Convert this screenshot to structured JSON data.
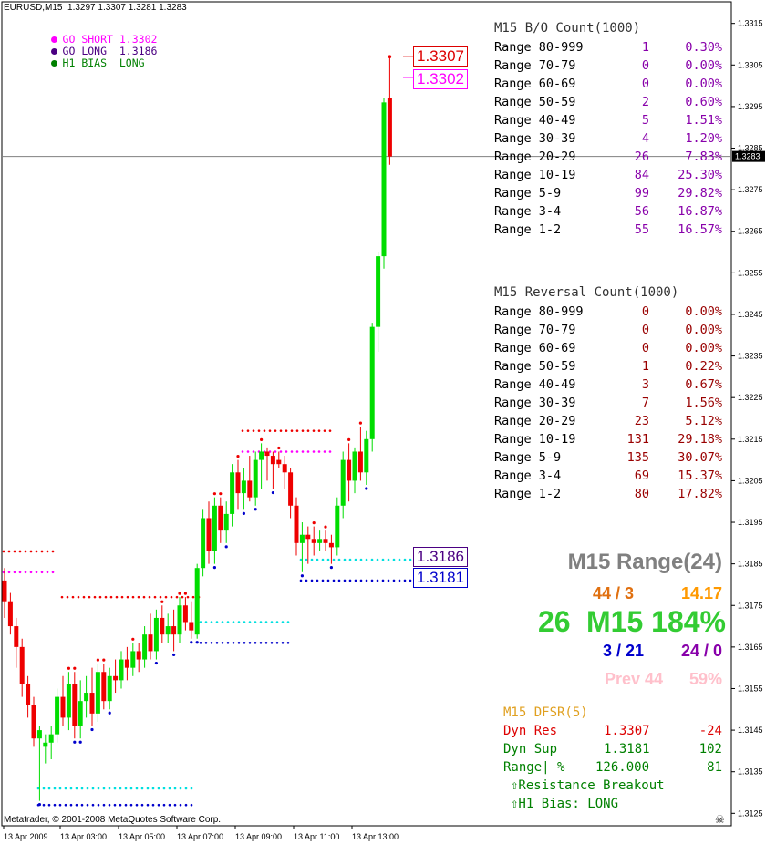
{
  "header": {
    "symbol_info": "EURUSD,M15  1.3297 1.3307 1.3281 1.3283",
    "signals": [
      {
        "label": "GO SHORT",
        "value": "1.3302",
        "color": "#ff00ff"
      },
      {
        "label": "GO LONG",
        "value": "1.3186",
        "color": "#4b0082"
      },
      {
        "label": "H1 BIAS",
        "value": "LONG",
        "color": "#008000"
      }
    ]
  },
  "copyright": "Metatrader, © 2001-2008 MetaQuotes Software Corp.",
  "current_price_label": "1.3283",
  "level_boxes": [
    {
      "name": "resistance-high",
      "value": "1.3307",
      "color": "#dd0000"
    },
    {
      "name": "go-short-level",
      "value": "1.3302",
      "color": "#ff00ff"
    },
    {
      "name": "go-long-level",
      "value": "1.3186",
      "color": "#4b0082"
    },
    {
      "name": "support-low",
      "value": "1.3181",
      "color": "#0000cc"
    }
  ],
  "bo_count": {
    "title": "M15 B/O Count(1000)",
    "rows": [
      {
        "label": "Range 80-999",
        "count": "1",
        "pct": "0.30%"
      },
      {
        "label": "Range 70-79",
        "count": "0",
        "pct": "0.00%"
      },
      {
        "label": "Range 60-69",
        "count": "0",
        "pct": "0.00%"
      },
      {
        "label": "Range 50-59",
        "count": "2",
        "pct": "0.60%"
      },
      {
        "label": "Range 40-49",
        "count": "5",
        "pct": "1.51%"
      },
      {
        "label": "Range 30-39",
        "count": "4",
        "pct": "1.20%"
      },
      {
        "label": "Range 20-29",
        "count": "26",
        "pct": "7.83%"
      },
      {
        "label": "Range 10-19",
        "count": "84",
        "pct": "25.30%"
      },
      {
        "label": "Range 5-9",
        "count": "99",
        "pct": "29.82%"
      },
      {
        "label": "Range 3-4",
        "count": "56",
        "pct": "16.87%"
      },
      {
        "label": "Range 1-2",
        "count": "55",
        "pct": "16.57%"
      }
    ]
  },
  "reversal_count": {
    "title": "M15 Reversal Count(1000)",
    "rows": [
      {
        "label": "Range 80-999",
        "count": "0",
        "pct": "0.00%"
      },
      {
        "label": "Range 70-79",
        "count": "0",
        "pct": "0.00%"
      },
      {
        "label": "Range 60-69",
        "count": "0",
        "pct": "0.00%"
      },
      {
        "label": "Range 50-59",
        "count": "1",
        "pct": "0.22%"
      },
      {
        "label": "Range 40-49",
        "count": "3",
        "pct": "0.67%"
      },
      {
        "label": "Range 30-39",
        "count": "7",
        "pct": "1.56%"
      },
      {
        "label": "Range 20-29",
        "count": "23",
        "pct": "5.12%"
      },
      {
        "label": "Range 10-19",
        "count": "131",
        "pct": "29.18%"
      },
      {
        "label": "Range 5-9",
        "count": "135",
        "pct": "30.07%"
      },
      {
        "label": "Range 3-4",
        "count": "69",
        "pct": "15.37%"
      },
      {
        "label": "Range 1-2",
        "count": "80",
        "pct": "17.82%"
      }
    ]
  },
  "range_panel": {
    "title": "M15 Range(24)",
    "ratio_a": "44 / 3",
    "value_a": "14.17",
    "current": "26",
    "current_label": "M15 184%",
    "ratio_b": "3 / 21",
    "ratio_c": "24 / 0",
    "prev": "Prev 44",
    "prev_pct": "59%"
  },
  "dfsr": {
    "title": "M15 DFSR(5)",
    "dyn_res_label": "Dyn Res",
    "dyn_res_value": "1.3307",
    "dyn_res_delta": "-24",
    "dyn_sup_label": "Dyn Sup",
    "dyn_sup_value": "1.3181",
    "dyn_sup_delta": "102",
    "range_label": "Range| %",
    "range_value": "126.000",
    "range_pct": "81",
    "msg1": "⇧Resistance Breakout",
    "msg2": "⇧H1 Bias: LONG"
  },
  "colors": {
    "bull": "#00dd00",
    "bear": "#ee0000",
    "bo_count": "#8800aa",
    "rev_count": "#990000",
    "range_title": "#808080",
    "ratio_a": "#e07010",
    "value_a": "#ff9900",
    "current": "#33cc33",
    "ratio_b": "#0000cc",
    "ratio_c": "#8800aa",
    "prev": "#ffc0cb",
    "dfsr_title": "#e0a020",
    "res": "#dd0000",
    "sup": "#008000",
    "neutral": "#008000"
  },
  "chart_data": {
    "type": "candlestick",
    "symbol": "EURUSD",
    "timeframe": "M15",
    "y_ticks": [
      "1.3315",
      "1.3305",
      "1.3295",
      "1.3285",
      "1.3275",
      "1.3265",
      "1.3255",
      "1.3245",
      "1.3235",
      "1.3225",
      "1.3215",
      "1.3205",
      "1.3195",
      "1.3185",
      "1.3175",
      "1.3165",
      "1.3155",
      "1.3145",
      "1.3135",
      "1.3125"
    ],
    "ylim": [
      1.3122,
      1.3318
    ],
    "x_ticks": [
      "13 Apr 2009",
      "13 Apr 03:00",
      "13 Apr 05:00",
      "13 Apr 07:00",
      "13 Apr 09:00",
      "13 Apr 11:00",
      "13 Apr 13:00"
    ],
    "candles": [
      [
        1.3181,
        1.3184,
        1.3172,
        1.3176
      ],
      [
        1.3176,
        1.3178,
        1.3168,
        1.317
      ],
      [
        1.317,
        1.3172,
        1.316,
        1.3165
      ],
      [
        1.3165,
        1.3167,
        1.3153,
        1.3156
      ],
      [
        1.3156,
        1.3158,
        1.3148,
        1.3151
      ],
      [
        1.3151,
        1.3153,
        1.3141,
        1.3143
      ],
      [
        1.3143,
        1.3146,
        1.3128,
        1.3145
      ],
      [
        1.3141,
        1.3144,
        1.3137,
        1.3142
      ],
      [
        1.3142,
        1.3146,
        1.3138,
        1.3144
      ],
      [
        1.3144,
        1.3155,
        1.3142,
        1.3153
      ],
      [
        1.3153,
        1.3158,
        1.3146,
        1.3148
      ],
      [
        1.3148,
        1.3159,
        1.3145,
        1.3156
      ],
      [
        1.3156,
        1.3159,
        1.3143,
        1.3146
      ],
      [
        1.3146,
        1.3157,
        1.3143,
        1.3152
      ],
      [
        1.3152,
        1.3158,
        1.3148,
        1.3154
      ],
      [
        1.3154,
        1.316,
        1.3146,
        1.3149
      ],
      [
        1.3149,
        1.3161,
        1.3147,
        1.3159
      ],
      [
        1.3159,
        1.3161,
        1.315,
        1.3152
      ],
      [
        1.3152,
        1.316,
        1.315,
        1.3158
      ],
      [
        1.3158,
        1.3162,
        1.3154,
        1.3157
      ],
      [
        1.3157,
        1.3164,
        1.3155,
        1.3162
      ],
      [
        1.3162,
        1.3165,
        1.3157,
        1.316
      ],
      [
        1.316,
        1.3166,
        1.3158,
        1.3164
      ],
      [
        1.3164,
        1.3166,
        1.3159,
        1.3162
      ],
      [
        1.3162,
        1.317,
        1.316,
        1.3168
      ],
      [
        1.3168,
        1.3173,
        1.3162,
        1.3164
      ],
      [
        1.3164,
        1.3174,
        1.3162,
        1.3172
      ],
      [
        1.3172,
        1.3175,
        1.3166,
        1.3168
      ],
      [
        1.3168,
        1.3173,
        1.3166,
        1.317
      ],
      [
        1.317,
        1.3174,
        1.3164,
        1.3168
      ],
      [
        1.3168,
        1.3177,
        1.3166,
        1.3175
      ],
      [
        1.3175,
        1.3177,
        1.3169,
        1.3171
      ],
      [
        1.3171,
        1.3176,
        1.3167,
        1.3169
      ],
      [
        1.3168,
        1.3185,
        1.3167,
        1.3184
      ],
      [
        1.3184,
        1.3198,
        1.3182,
        1.3196
      ],
      [
        1.3196,
        1.32,
        1.3185,
        1.3188
      ],
      [
        1.3188,
        1.3201,
        1.3185,
        1.3199
      ],
      [
        1.3199,
        1.3201,
        1.319,
        1.3193
      ],
      [
        1.3193,
        1.32,
        1.319,
        1.3197
      ],
      [
        1.3197,
        1.3209,
        1.3194,
        1.3207
      ],
      [
        1.3207,
        1.321,
        1.3198,
        1.3202
      ],
      [
        1.3202,
        1.3208,
        1.3198,
        1.3205
      ],
      [
        1.3205,
        1.3211,
        1.32,
        1.3201
      ],
      [
        1.3201,
        1.3212,
        1.3199,
        1.321
      ],
      [
        1.321,
        1.3214,
        1.3203,
        1.3212
      ],
      [
        1.3212,
        1.3213,
        1.3205,
        1.3211
      ],
      [
        1.3211,
        1.3212,
        1.3203,
        1.3209
      ],
      [
        1.321,
        1.3212,
        1.3208,
        1.3209
      ],
      [
        1.3209,
        1.3211,
        1.3203,
        1.3207
      ],
      [
        1.3207,
        1.3208,
        1.3196,
        1.3199
      ],
      [
        1.3199,
        1.3201,
        1.3187,
        1.319
      ],
      [
        1.319,
        1.3195,
        1.3183,
        1.3192
      ],
      [
        1.3192,
        1.3194,
        1.3185,
        1.3191
      ],
      [
        1.3191,
        1.3194,
        1.3187,
        1.319
      ],
      [
        1.319,
        1.3193,
        1.3188,
        1.3191
      ],
      [
        1.3191,
        1.3193,
        1.3188,
        1.319
      ],
      [
        1.319,
        1.3192,
        1.3185,
        1.3189
      ],
      [
        1.3189,
        1.3201,
        1.3187,
        1.3199
      ],
      [
        1.3199,
        1.3212,
        1.3196,
        1.321
      ],
      [
        1.321,
        1.3214,
        1.32,
        1.3205
      ],
      [
        1.3205,
        1.3213,
        1.3202,
        1.3212
      ],
      [
        1.3212,
        1.3218,
        1.3205,
        1.3207
      ],
      [
        1.3207,
        1.3217,
        1.3204,
        1.3215
      ],
      [
        1.3215,
        1.3243,
        1.3212,
        1.3242
      ],
      [
        1.3242,
        1.326,
        1.3236,
        1.3259
      ],
      [
        1.3259,
        1.3297,
        1.3256,
        1.3296
      ],
      [
        1.3297,
        1.3307,
        1.3281,
        1.3283
      ]
    ],
    "levels": [
      {
        "name": "dyn-res-red",
        "value": 1.3307,
        "color": "#dd0000"
      },
      {
        "name": "go-short-magenta",
        "value": 1.3302,
        "color": "#ff00ff"
      },
      {
        "name": "go-long-cyan",
        "value": 1.3186,
        "color": "#00e0e0"
      },
      {
        "name": "dyn-sup-blue",
        "value": 1.3181,
        "color": "#0000cc"
      }
    ],
    "current_price": 1.3283
  }
}
